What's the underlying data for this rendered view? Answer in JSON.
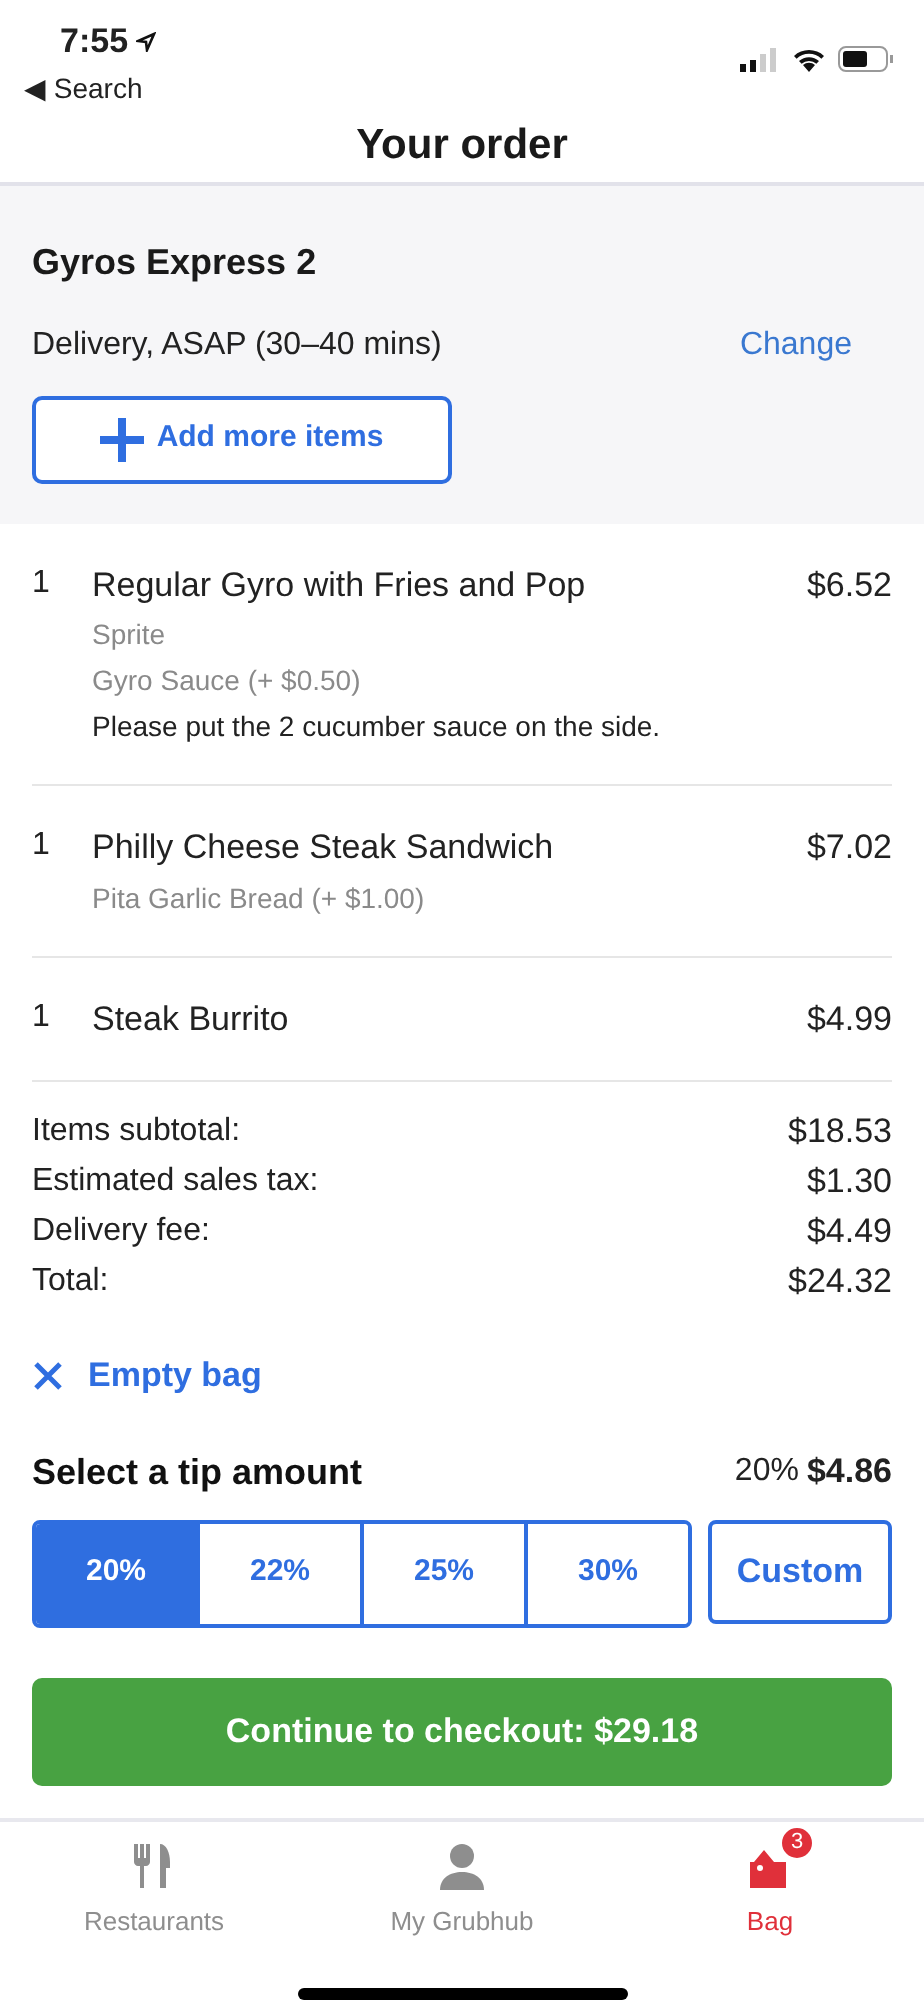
{
  "status_bar": {
    "time": "7:55",
    "back_label": "◀ Search"
  },
  "header": {
    "title": "Your order"
  },
  "restaurant": {
    "name": "Gyros Express 2",
    "delivery": "Delivery, ASAP (30–40 mins)",
    "change_link": "Change",
    "add_button": "Add more items"
  },
  "items": [
    {
      "qty": "1",
      "name": "Regular Gyro with Fries and Pop",
      "price": "$6.52",
      "details": [
        {
          "kind": "option",
          "text": "Sprite"
        },
        {
          "kind": "option",
          "text": "Gyro Sauce (+ $0.50)"
        },
        {
          "kind": "note",
          "text": "Please put the 2 cucumber sauce on the side."
        }
      ]
    },
    {
      "qty": "1",
      "name": "Philly Cheese Steak Sandwich",
      "price": "$7.02",
      "details": [
        {
          "kind": "option",
          "text": "Pita Garlic Bread (+ $1.00)"
        }
      ]
    },
    {
      "qty": "1",
      "name": "Steak Burrito",
      "price": "$4.99"
    }
  ],
  "totals": [
    {
      "label": "Items subtotal:",
      "value": "$18.53"
    },
    {
      "label": "Estimated sales tax:",
      "value": "$1.30"
    },
    {
      "label": "Delivery fee:",
      "value": "$4.49"
    },
    {
      "label": "Total:",
      "value": "$24.32"
    }
  ],
  "empty_bag": "Empty bag",
  "tip": {
    "title": "Select a tip amount",
    "summary_percent": "20%",
    "summary_amount": "$4.86",
    "options": [
      {
        "label": "20%",
        "selected": true
      },
      {
        "label": "22%",
        "selected": false
      },
      {
        "label": "25%",
        "selected": false
      },
      {
        "label": "30%",
        "selected": false
      }
    ],
    "custom": "Custom"
  },
  "checkout_button": "Continue to checkout: $29.18",
  "tabs": [
    {
      "kind": "restaurants",
      "label": "Restaurants",
      "selected": false
    },
    {
      "kind": "account",
      "label": "My Grubhub",
      "selected": false
    },
    {
      "kind": "bag",
      "label": "Bag",
      "selected": true,
      "badge": "3"
    }
  ]
}
